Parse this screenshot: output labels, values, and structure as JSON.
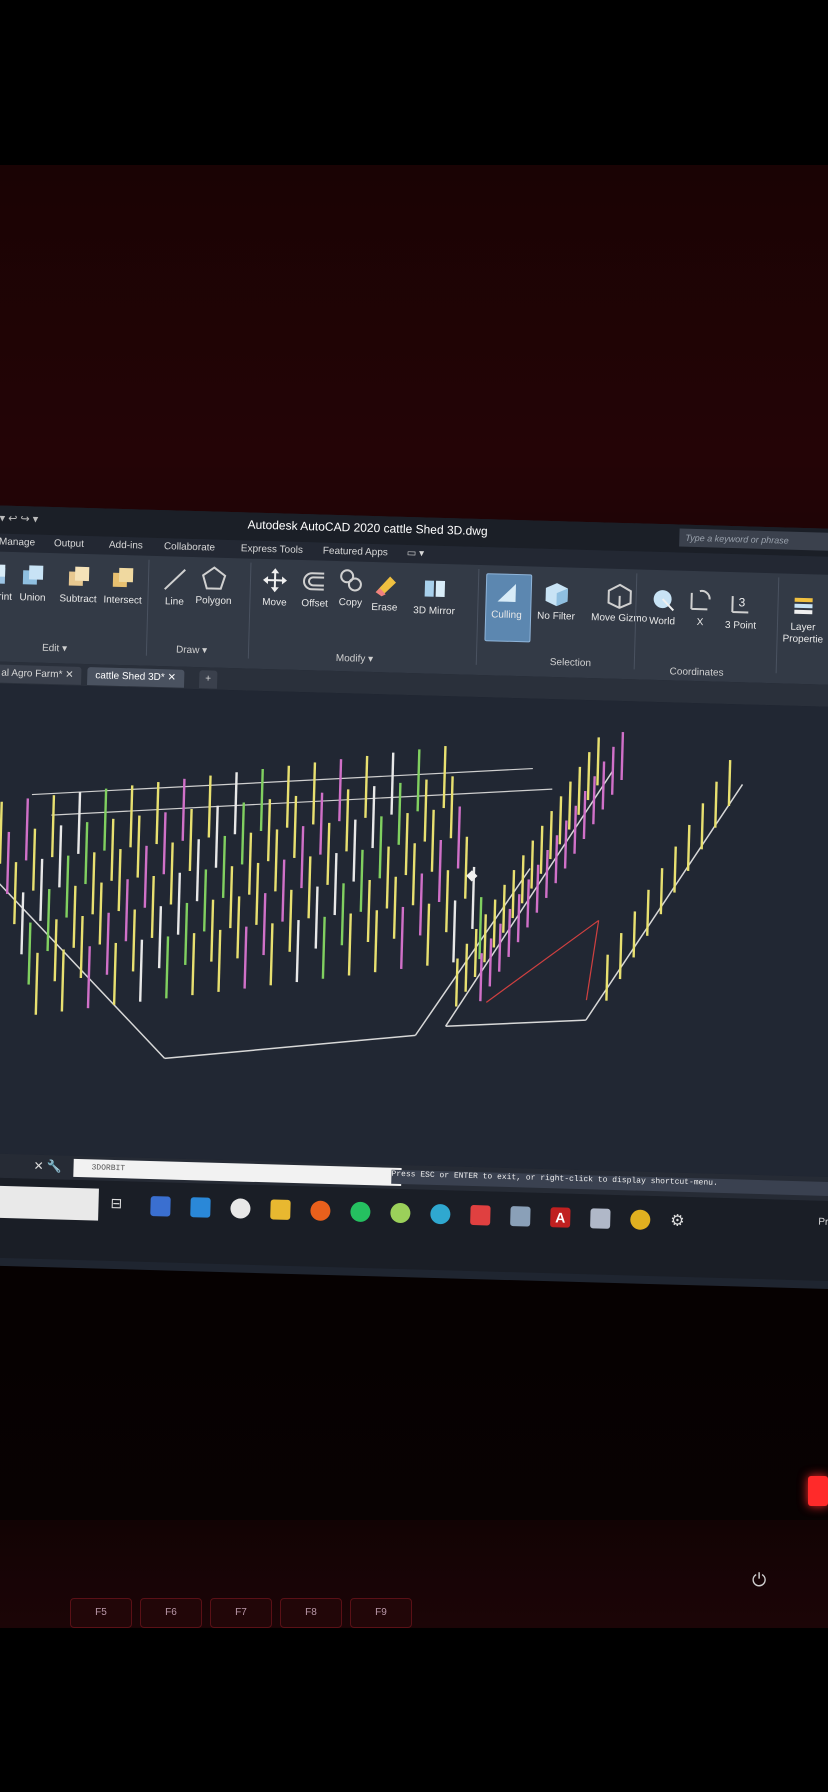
{
  "window": {
    "title": "Autodesk AutoCAD 2020   cattle Shed 3D.dwg",
    "search_placeholder": "Type a keyword or phrase",
    "qa_toolbar": "▾ ↩ ↪ ▾"
  },
  "ribbon_tabs": [
    {
      "label": "Manage"
    },
    {
      "label": "Output"
    },
    {
      "label": "Add-ins"
    },
    {
      "label": "Collaborate"
    },
    {
      "label": "Express Tools"
    },
    {
      "label": "Featured Apps"
    }
  ],
  "panels": {
    "edit": {
      "label": "Edit ▾",
      "tools": [
        {
          "label": "Imprint"
        },
        {
          "label": "Union"
        },
        {
          "label": "Subtract"
        },
        {
          "label": "Intersect"
        }
      ]
    },
    "draw": {
      "label": "Draw ▾",
      "tools": [
        {
          "label": "Line"
        },
        {
          "label": "Polygon"
        }
      ]
    },
    "modify": {
      "label": "Modify ▾",
      "tools": [
        {
          "label": "Move"
        },
        {
          "label": "Offset"
        },
        {
          "label": "Copy"
        },
        {
          "label": "Erase"
        },
        {
          "label": "3D Mirror"
        }
      ]
    },
    "selection": {
      "label": "Selection",
      "tools": [
        {
          "label": "Culling"
        },
        {
          "label": "No Filter"
        },
        {
          "label": "Move Gizmo"
        }
      ]
    },
    "coordinates": {
      "label": "Coordinates",
      "tools": [
        {
          "label": "World"
        },
        {
          "label": "X"
        },
        {
          "label": "3 Point"
        }
      ]
    },
    "layers": {
      "label": "Layer Properties"
    }
  },
  "document_tabs": [
    {
      "label": "al Agro Farm*",
      "active": false
    },
    {
      "label": "cattle Shed 3D*",
      "active": true
    }
  ],
  "command_line": {
    "input": "3DORBIT",
    "hint": "Press ESC or ENTER to exit, or right-click to display shortcut-menu."
  },
  "taskbar": {
    "right_text": "Press"
  },
  "keyboard_keys": [
    "F5",
    "F6",
    "F7",
    "F8",
    "F9"
  ],
  "colors": {
    "viewport_bg": "#212733",
    "ribbon_bg": "#333a46",
    "culling_active": "#5c87b0",
    "post_yellow": "#e8e070",
    "post_magenta": "#d070c8",
    "post_white": "#e8e8e8",
    "post_green": "#80d060"
  }
}
